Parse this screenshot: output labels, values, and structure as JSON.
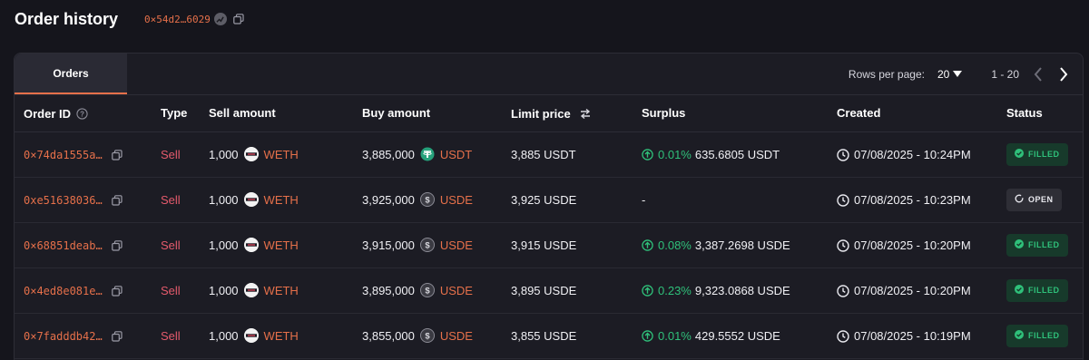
{
  "header": {
    "title": "Order history",
    "address": "0×54d2…6029"
  },
  "tabs": [
    {
      "label": "Orders",
      "active": true
    }
  ],
  "pagination": {
    "rows_label": "Rows per page:",
    "rows_value": "20",
    "range": "1 - 20"
  },
  "columns": {
    "order_id": "Order ID",
    "type": "Type",
    "sell_amount": "Sell amount",
    "buy_amount": "Buy amount",
    "limit_price": "Limit price",
    "surplus": "Surplus",
    "created": "Created",
    "status": "Status"
  },
  "colors": {
    "accent": "#e6704a",
    "sell": "#e45a6c",
    "success": "#2fc07a",
    "background": "#15151c"
  },
  "rows": [
    {
      "id": "0×74da1555a…",
      "type": "Sell",
      "sell_amount": "1,000",
      "sell_token": "WETH",
      "sell_icon": "weth-icon",
      "buy_amount": "3,885,000",
      "buy_token": "USDT",
      "buy_icon": "usdt-icon",
      "limit_price": "3,885 USDT",
      "surplus_pct": "0.01%",
      "surplus_amt": "635.6805 USDT",
      "created": "07/08/2025 - 10:24PM",
      "status": "FILLED"
    },
    {
      "id": "0xe51638036…",
      "type": "Sell",
      "sell_amount": "1,000",
      "sell_token": "WETH",
      "sell_icon": "weth-icon",
      "buy_amount": "3,925,000",
      "buy_token": "USDE",
      "buy_icon": "usde-icon",
      "limit_price": "3,925 USDE",
      "surplus_pct": "",
      "surplus_amt": "-",
      "created": "07/08/2025 - 10:23PM",
      "status": "OPEN"
    },
    {
      "id": "0×68851deab…",
      "type": "Sell",
      "sell_amount": "1,000",
      "sell_token": "WETH",
      "sell_icon": "weth-icon",
      "buy_amount": "3,915,000",
      "buy_token": "USDE",
      "buy_icon": "usde-icon",
      "limit_price": "3,915 USDE",
      "surplus_pct": "0.08%",
      "surplus_amt": "3,387.2698 USDE",
      "created": "07/08/2025 - 10:20PM",
      "status": "FILLED"
    },
    {
      "id": "0×4ed8e081e…",
      "type": "Sell",
      "sell_amount": "1,000",
      "sell_token": "WETH",
      "sell_icon": "weth-icon",
      "buy_amount": "3,895,000",
      "buy_token": "USDE",
      "buy_icon": "usde-icon",
      "limit_price": "3,895 USDE",
      "surplus_pct": "0.23%",
      "surplus_amt": "9,323.0868 USDE",
      "created": "07/08/2025 - 10:20PM",
      "status": "FILLED"
    },
    {
      "id": "0×7fadddb42…",
      "type": "Sell",
      "sell_amount": "1,000",
      "sell_token": "WETH",
      "sell_icon": "weth-icon",
      "buy_amount": "3,855,000",
      "buy_token": "USDE",
      "buy_icon": "usde-icon",
      "limit_price": "3,855 USDE",
      "surplus_pct": "0.01%",
      "surplus_amt": "429.5552 USDE",
      "created": "07/08/2025 - 10:19PM",
      "status": "FILLED"
    }
  ]
}
